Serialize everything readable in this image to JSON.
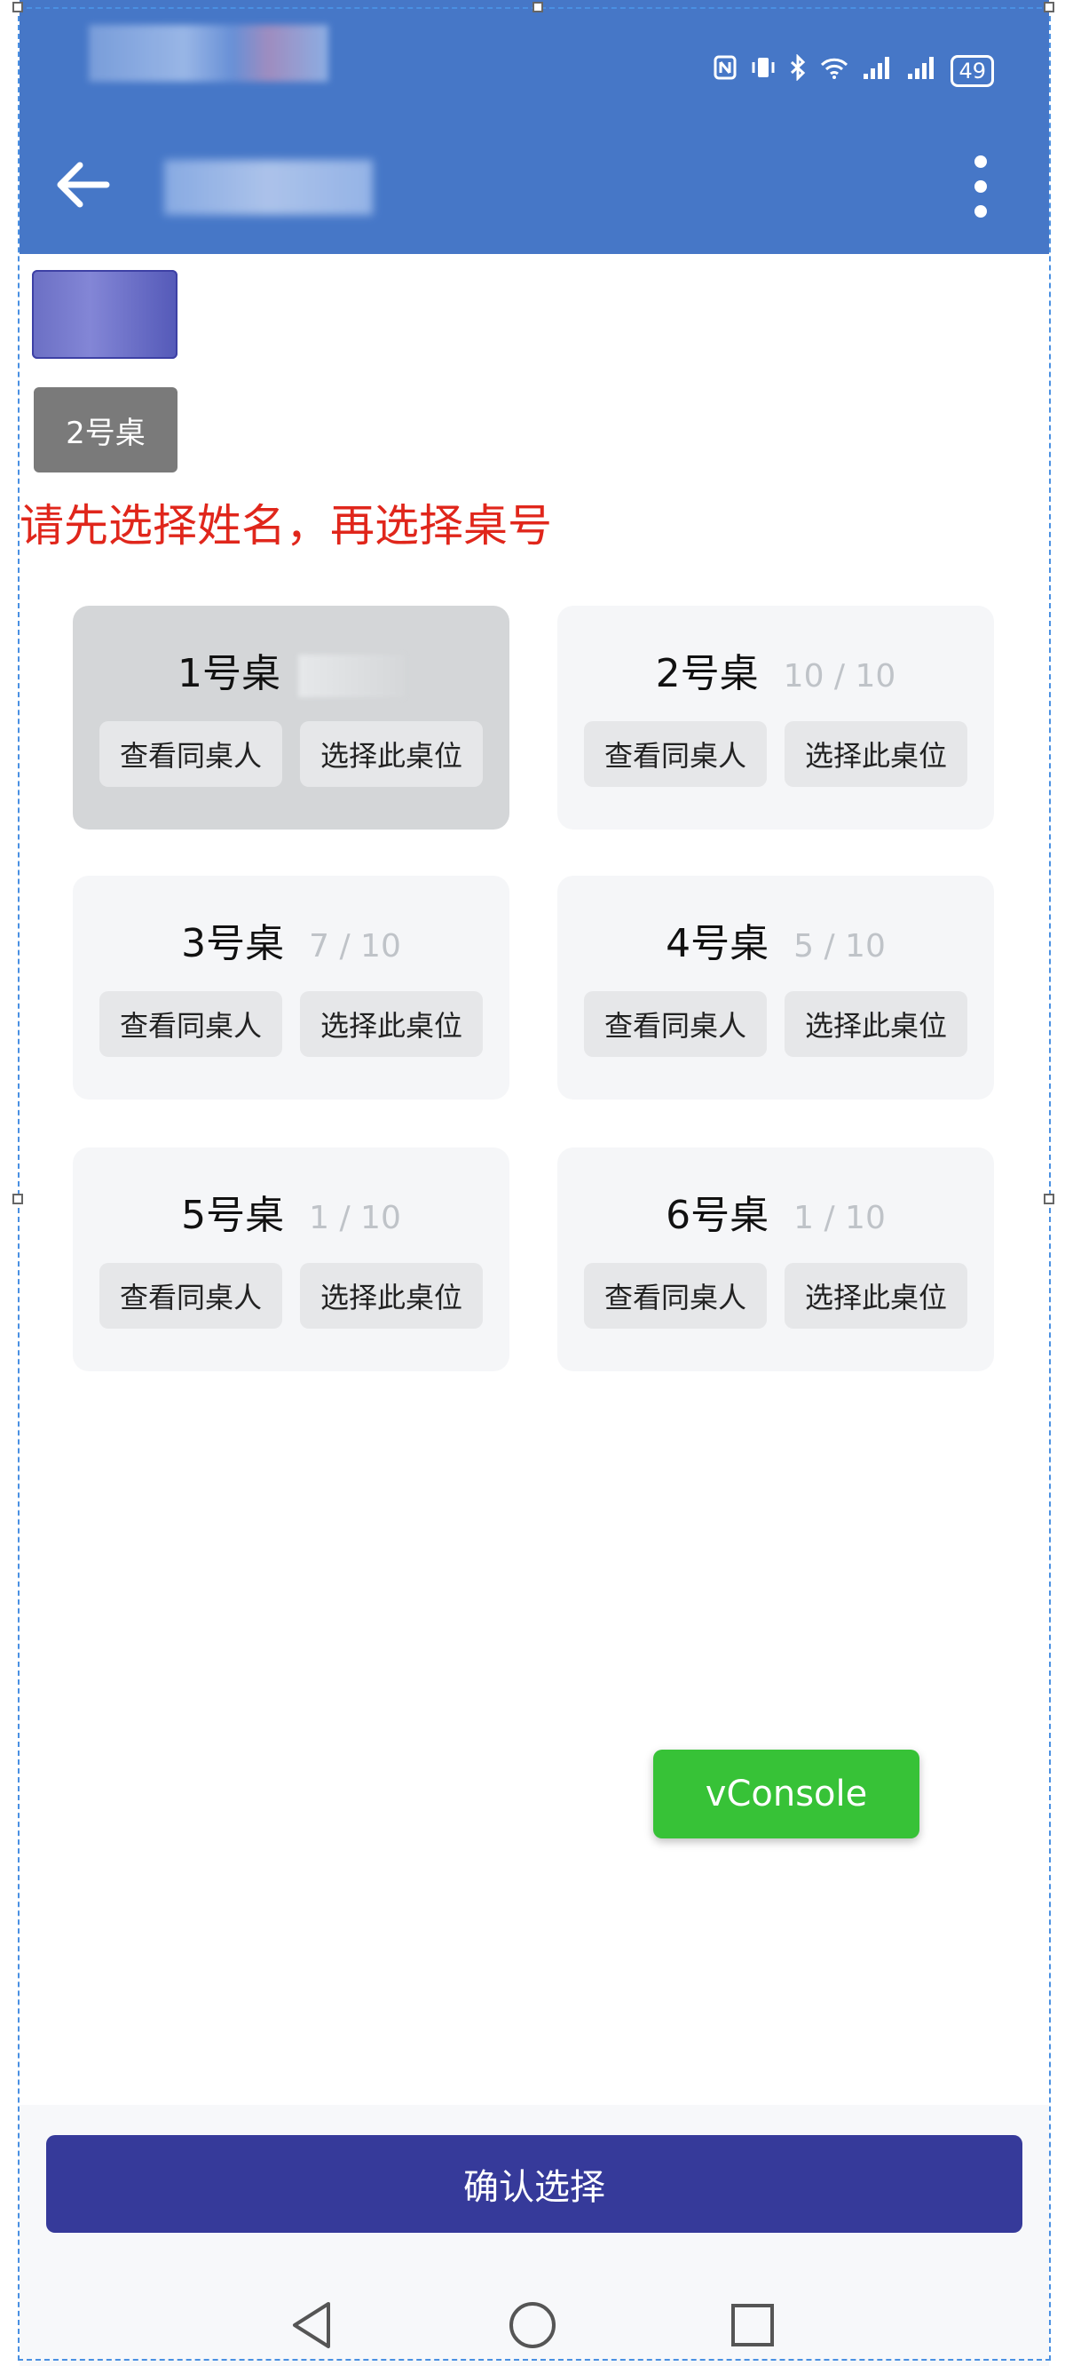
{
  "status_bar": {
    "icons": [
      "nfc-icon",
      "vibrate-icon",
      "bluetooth-icon",
      "wifi-icon",
      "signal-icon",
      "signal-icon"
    ],
    "battery": "49"
  },
  "app_bar": {
    "back_icon": "arrow-left-icon",
    "menu_icon": "more-vertical-icon"
  },
  "selected_table_tag": "2号桌",
  "hint": "请先选择姓名，再选择桌号",
  "tables": [
    {
      "name": "1号桌",
      "count": "",
      "selected": true
    },
    {
      "name": "2号桌",
      "count": "10 / 10",
      "selected": false
    },
    {
      "name": "3号桌",
      "count": "7 / 10",
      "selected": false
    },
    {
      "name": "4号桌",
      "count": "5 / 10",
      "selected": false
    },
    {
      "name": "5号桌",
      "count": "1 / 10",
      "selected": false
    },
    {
      "name": "6号桌",
      "count": "1 / 10",
      "selected": false
    }
  ],
  "buttons": {
    "view": "查看同桌人",
    "select": "选择此桌位"
  },
  "vconsole": "vConsole",
  "confirm": "确认选择",
  "nav": [
    "back-triangle-icon",
    "home-circle-icon",
    "recents-square-icon"
  ],
  "colors": {
    "app_bar": "#4677c7",
    "hint": "#e0261b",
    "confirm": "#363a9a",
    "vconsole": "#37c237"
  }
}
